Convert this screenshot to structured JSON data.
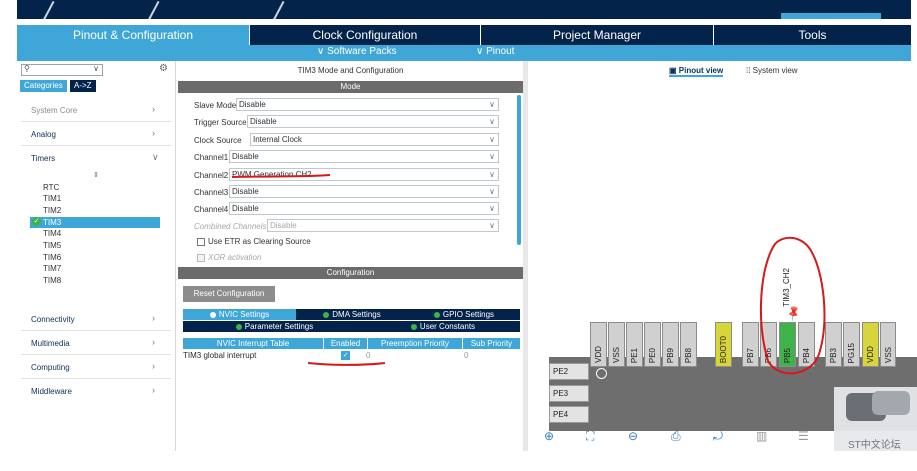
{
  "tabs": {
    "pinout": "Pinout & Configuration",
    "clock": "Clock Configuration",
    "project": "Project Manager",
    "tools": "Tools"
  },
  "subtabs": {
    "software_packs": "∨ Software Packs",
    "pinout": "∨ Pinout"
  },
  "left": {
    "categories_tab": "Categories",
    "az_tab": "A->Z",
    "categories": {
      "system_core": "System Core",
      "analog": "Analog",
      "timers": "Timers",
      "connectivity": "Connectivity",
      "multimedia": "Multimedia",
      "computing": "Computing",
      "middleware": "Middleware"
    },
    "timers": [
      "RTC",
      "TIM1",
      "TIM2",
      "TIM3",
      "TIM4",
      "TIM5",
      "TIM6",
      "TIM7",
      "TIM8"
    ],
    "selected_timer": "TIM3"
  },
  "mid": {
    "title": "TIM3 Mode and Configuration",
    "mode_bar": "Mode",
    "slave_mode_label": "Slave Mode",
    "slave_mode_value": "Disable",
    "trigger_label": "Trigger Source",
    "trigger_value": "Disable",
    "clock_label": "Clock Source",
    "clock_value": "Internal Clock",
    "ch1_label": "Channel1",
    "ch1_value": "Disable",
    "ch2_label": "Channel2",
    "ch2_value": "PWM Generation CH2",
    "ch3_label": "Channel3",
    "ch3_value": "Disable",
    "ch4_label": "Channel4",
    "ch4_value": "Disable",
    "combined_label": "Combined Channels",
    "combined_value": "Disable",
    "etr_label": "Use ETR as Clearing Source",
    "xor_label": "XOR activation",
    "config_bar": "Configuration",
    "reset_button": "Reset Configuration",
    "nvic_tab": "NVIC Settings",
    "dma_tab": "DMA Settings",
    "gpio_tab": "GPIO Settings",
    "param_tab": "Parameter Settings",
    "user_tab": "User Constants",
    "table_headers": [
      "NVIC Interrupt Table",
      "Enabled",
      "Preemption Priority",
      "Sub Priority"
    ],
    "table_row": {
      "name": "TIM3 global interrupt",
      "preemption": "0",
      "sub": "0"
    }
  },
  "right": {
    "pinout_view": "Pinout view",
    "system_view": "System view",
    "top_pins": [
      "VDD",
      "VSS",
      "PE1",
      "PE0",
      "PB9",
      "PB8",
      "BOOT0",
      "PB7",
      "PB6",
      "PB5",
      "PB4",
      "PB3",
      "PG15",
      "VDD",
      "VSS"
    ],
    "left_pins": [
      "PE2",
      "PE3",
      "PE4"
    ],
    "pin_annotation": "TIM3_CH2",
    "forum_text": "ST中文论坛"
  },
  "colors": {
    "navy": "#03234b",
    "accent": "#3ea7d8",
    "pin_green": "#3fb24a",
    "pin_yellow": "#d8d53a",
    "annotation_red": "#d6191b"
  }
}
